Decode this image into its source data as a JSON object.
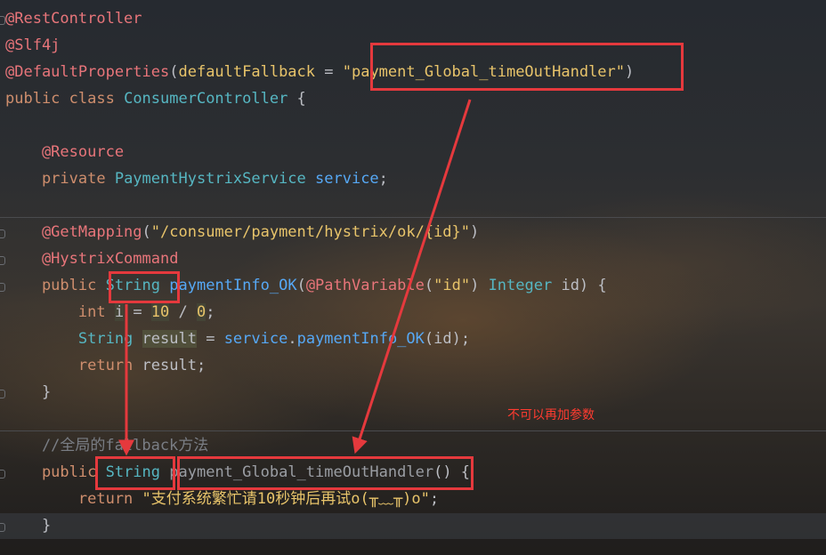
{
  "editor": {
    "lines": [
      [
        {
          "t": "@RestController",
          "c": "tk-ann-red"
        }
      ],
      [
        {
          "t": "@Slf4j",
          "c": "tk-ann-red"
        }
      ],
      [
        {
          "t": "@DefaultProperties",
          "c": "tk-ann-red"
        },
        {
          "t": "(",
          "c": "tk-plain"
        },
        {
          "t": "defaultFallback",
          "c": "tk-str2"
        },
        {
          "t": " = ",
          "c": "tk-plain"
        },
        {
          "t": "\"payment_Global_timeOutHandler\"",
          "c": "tk-str2"
        },
        {
          "t": ")",
          "c": "tk-plain"
        }
      ],
      [
        {
          "t": "public ",
          "c": "tk-kw"
        },
        {
          "t": "class ",
          "c": "tk-kw"
        },
        {
          "t": "ConsumerController",
          "c": "tk-type"
        },
        {
          "t": " {",
          "c": "tk-plain"
        }
      ],
      [
        {
          "t": "",
          "c": "tk-plain"
        }
      ],
      [
        {
          "t": "    @Resource",
          "c": "tk-ann-red"
        }
      ],
      [
        {
          "t": "    private ",
          "c": "tk-kw"
        },
        {
          "t": "PaymentHystrixService",
          "c": "tk-type"
        },
        {
          "t": " ",
          "c": "tk-plain"
        },
        {
          "t": "service",
          "c": "tk-fn"
        },
        {
          "t": ";",
          "c": "tk-plain"
        }
      ],
      [
        {
          "t": "",
          "c": "tk-plain"
        }
      ],
      [
        {
          "t": "    @GetMapping",
          "c": "tk-ann-red"
        },
        {
          "t": "(",
          "c": "tk-plain"
        },
        {
          "t": "\"/consumer/payment/hystrix/ok/{id}\"",
          "c": "tk-str2"
        },
        {
          "t": ")",
          "c": "tk-plain"
        }
      ],
      [
        {
          "t": "    @HystrixCommand",
          "c": "tk-ann-red"
        }
      ],
      [
        {
          "t": "    public ",
          "c": "tk-kw"
        },
        {
          "t": "String",
          "c": "tk-type"
        },
        {
          "t": " ",
          "c": "tk-plain"
        },
        {
          "t": "paymentInfo_OK",
          "c": "tk-fn"
        },
        {
          "t": "(",
          "c": "tk-plain"
        },
        {
          "t": "@PathVariable",
          "c": "tk-ann-red"
        },
        {
          "t": "(",
          "c": "tk-plain"
        },
        {
          "t": "\"id\"",
          "c": "tk-str2"
        },
        {
          "t": ") ",
          "c": "tk-plain"
        },
        {
          "t": "Integer",
          "c": "tk-type"
        },
        {
          "t": " id) {",
          "c": "tk-plain"
        }
      ],
      [
        {
          "t": "        int ",
          "c": "tk-kw"
        },
        {
          "t": "i",
          "c": "tk-plain tk-hl2"
        },
        {
          "t": " = ",
          "c": "tk-plain"
        },
        {
          "t": "10",
          "c": "tk-str2 tk-hl2"
        },
        {
          "t": " / ",
          "c": "tk-plain"
        },
        {
          "t": "0",
          "c": "tk-str2 tk-hl2"
        },
        {
          "t": ";",
          "c": "tk-plain"
        }
      ],
      [
        {
          "t": "        String",
          "c": "tk-type"
        },
        {
          "t": " ",
          "c": "tk-plain"
        },
        {
          "t": "result",
          "c": "tk-plain tk-hl"
        },
        {
          "t": " = ",
          "c": "tk-plain"
        },
        {
          "t": "service",
          "c": "tk-fn"
        },
        {
          "t": ".",
          "c": "tk-plain"
        },
        {
          "t": "paymentInfo_OK",
          "c": "tk-fn"
        },
        {
          "t": "(id);",
          "c": "tk-plain"
        }
      ],
      [
        {
          "t": "        return ",
          "c": "tk-kw"
        },
        {
          "t": "result;",
          "c": "tk-plain"
        }
      ],
      [
        {
          "t": "    }",
          "c": "tk-plain"
        }
      ],
      [
        {
          "t": "",
          "c": "tk-plain"
        }
      ],
      [
        {
          "t": "    //全局的fallback方法",
          "c": "tk-cmt"
        }
      ],
      [
        {
          "t": "    public ",
          "c": "tk-kw"
        },
        {
          "t": "String",
          "c": "tk-type"
        },
        {
          "t": " ",
          "c": "tk-plain"
        },
        {
          "t": "payment_Global_timeOutHandler",
          "c": "tk-gray"
        },
        {
          "t": "() {",
          "c": "tk-plain"
        }
      ],
      [
        {
          "t": "        return ",
          "c": "tk-kw"
        },
        {
          "t": "\"支付系统繁忙请10秒钟后再试o(╥﹏╥)o\"",
          "c": "tk-str2"
        },
        {
          "t": ";",
          "c": "tk-plain"
        }
      ],
      [
        {
          "t": "    }",
          "c": "tk-plain"
        }
      ]
    ]
  },
  "annotation": {
    "note": "不可以再加参数",
    "color": "#ff3b30",
    "box_color": "#e5393d"
  }
}
